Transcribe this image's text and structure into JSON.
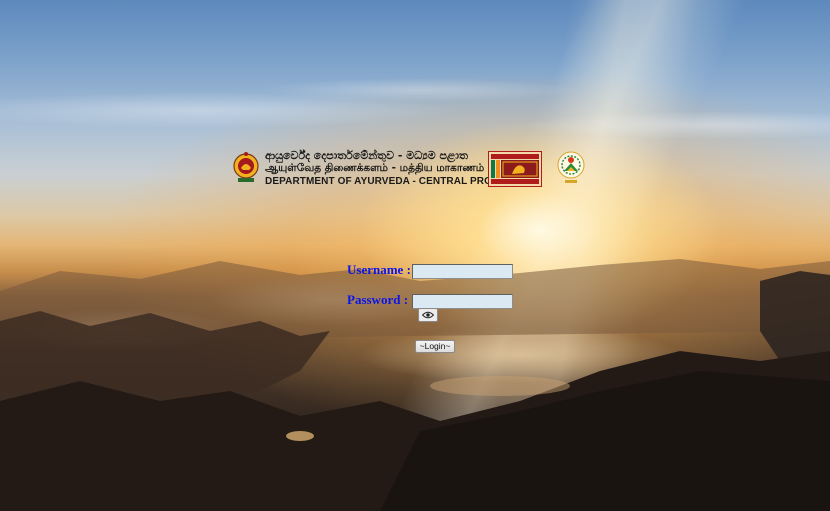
{
  "header": {
    "title_sinhala": "ආයුර්වේද දෙපාර්තමේන්තුව - මධ්‍යම පළාත",
    "title_tamil": "ஆயுள்வேத திணைக்களம் - மத்திய மாகாணம்",
    "title_english": "DEPARTMENT OF AYURVEDA - CENTRAL PROVINCE"
  },
  "login_form": {
    "username_label": "Username :",
    "username_value": "",
    "password_label": "Password :",
    "password_value": "",
    "show_password_icon": "eye-icon",
    "login_button_label": "~Login~"
  },
  "colors": {
    "label_color": "#0b15e8",
    "input_background": "#dbe9f3"
  }
}
